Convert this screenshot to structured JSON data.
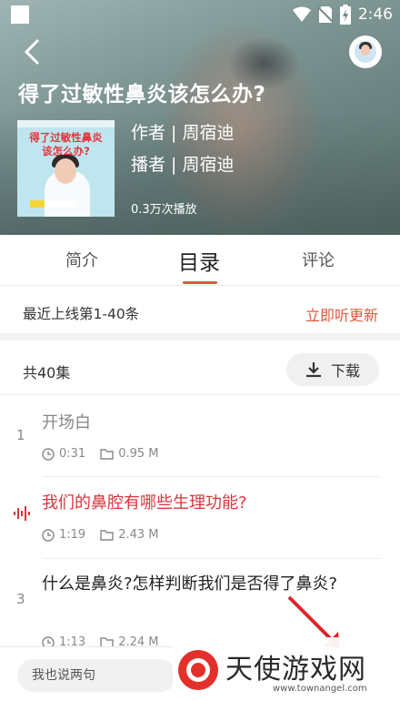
{
  "status_bar": {
    "time": "2:46"
  },
  "header": {
    "title": "得了过敏性鼻炎该怎么办?",
    "author": "作者 | 周宿迪",
    "narrator": "播者 | 周宿迪",
    "play_count": "0.3万次播放",
    "cover_title": "得了过敏性鼻炎\n该怎么办?"
  },
  "tabs": [
    {
      "label": "简介"
    },
    {
      "label": "目录",
      "selected": true
    },
    {
      "label": "评论"
    }
  ],
  "update_row": {
    "text": "最近上线第1-40条",
    "link": "立即听更新"
  },
  "count_row": {
    "count": "共40集",
    "download_label": "下载"
  },
  "episodes": [
    {
      "index": "1",
      "title": "开场白",
      "duration": "0:31",
      "size": "0.95 M",
      "playing": false
    },
    {
      "index": "",
      "title": "我们的鼻腔有哪些生理功能?",
      "duration": "1:19",
      "size": "2.43 M",
      "playing": true
    },
    {
      "index": "3",
      "title": "什么是鼻炎?怎样判断我们是否得了鼻炎?",
      "duration": "1:13",
      "size": "2.24 M",
      "playing": false
    }
  ],
  "comment_bar": {
    "placeholder": "我也说两句"
  },
  "watermark": {
    "text": "天使游戏网",
    "url": "www.townangel.com"
  },
  "colors": {
    "accent": "#e0573a",
    "playing_title": "#d9363e"
  }
}
